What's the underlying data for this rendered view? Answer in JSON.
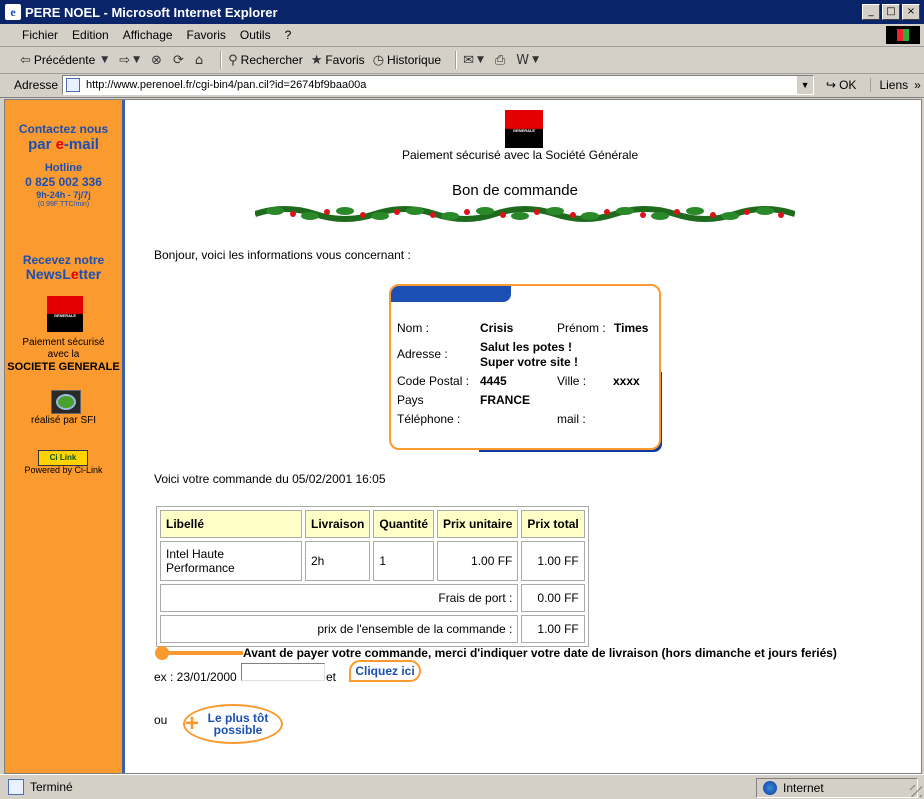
{
  "window": {
    "title": "PERE NOEL - Microsoft Internet Explorer"
  },
  "menu": [
    "Fichier",
    "Edition",
    "Affichage",
    "Favoris",
    "Outils",
    "?"
  ],
  "toolbar": {
    "back": "Précédente",
    "search": "Rechercher",
    "favorites": "Favoris",
    "history": "Historique"
  },
  "address": {
    "label": "Adresse",
    "url": "http://www.perenoel.fr/cgi-bin4/pan.cil?id=2674bf9baa00a",
    "ok": "OK",
    "links": "Liens"
  },
  "sidebar": {
    "contact": "Contactez nous",
    "email_prefix": "par ",
    "email_e": "e",
    "email_suffix": "-mail",
    "hotline": "Hotline",
    "phone": "0 825 002 336",
    "hours": "9h-24h - 7j/7j",
    "price": "(0.99F TTC/min)",
    "newsletter_line1": "Recevez notre",
    "newsletter_pre": "NewsL",
    "newsletter_e": "e",
    "newsletter_post": "tter",
    "pay_line1": "Paiement sécurisé",
    "pay_line2": "avec la",
    "pay_line3": "SOCIETE GENERALE",
    "logo_text": "GENERALE",
    "sfi": "réalisé par SFI",
    "cilink_logo": "Ci Link",
    "powered": "Powered by Ci-Link"
  },
  "main": {
    "logo_text": "GENERALE",
    "payment_secure": "Paiement sécurisé avec la Société Générale",
    "title": "Bon de commande",
    "greeting": "Bonjour, voici les informations vous concernant :",
    "customer": {
      "nom_label": "Nom :",
      "nom": "Crisis",
      "prenom_label": "Prénom :",
      "prenom": "Times",
      "adresse_label": "Adresse :",
      "adresse_line1": "Salut les potes !",
      "adresse_line2": "Super votre site !",
      "cp_label": "Code Postal :",
      "cp": "4445",
      "ville_label": "Ville :",
      "ville": "xxxx",
      "pays_label": "Pays",
      "pays": "FRANCE",
      "tel_label": "Téléphone :",
      "mail_label": "mail :"
    },
    "order_intro": "Voici votre commande du 05/02/2001 16:05",
    "table": {
      "headers": [
        "Libellé",
        "Livraison",
        "Quantité",
        "Prix unitaire",
        "Prix total"
      ],
      "row": [
        "Intel Haute Performance",
        "2h",
        "1",
        "1.00 FF",
        "1.00 FF"
      ],
      "shipping_label": "Frais de port :",
      "shipping_value": "0.00 FF",
      "total_label": "prix de l'ensemble de la commande :",
      "total_value": "1.00 FF"
    },
    "delivery_notice": "Avant de payer votre commande, merci d'indiquer votre date de livraison (hors dimanche et jours feriés)",
    "example": "ex : 23/01/2000",
    "date_value": "",
    "et": "et",
    "cliquez": "Cliquez ici",
    "ou": "ou",
    "plus_tot_line1": "Le plus tôt",
    "plus_tot_line2": "possible"
  },
  "status": {
    "text": "Terminé",
    "zone": "Internet"
  },
  "colors": {
    "sidebar_bg": "#fb9a2e",
    "brand_blue": "#1b4fb4",
    "sg_red": "#e40000",
    "table_header_bg": "#ffffc8"
  }
}
